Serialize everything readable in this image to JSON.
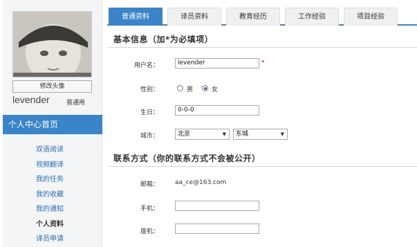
{
  "sidebar": {
    "avatar_button": "修改头像",
    "username": "levender",
    "user_type": "普通用",
    "home": "个人中心首页",
    "items": [
      {
        "label": "双语阅读"
      },
      {
        "label": "视频翻译"
      },
      {
        "label": "我的任务"
      },
      {
        "label": "我的收藏"
      },
      {
        "label": "我的通知"
      },
      {
        "label": "个人资料"
      },
      {
        "label": "译员申请"
      }
    ]
  },
  "tabs": [
    {
      "label": "普通资料"
    },
    {
      "label": "译员资料"
    },
    {
      "label": "教育经历"
    },
    {
      "label": "工作经验"
    },
    {
      "label": "项目经验"
    }
  ],
  "basic": {
    "title": "基本信息（加*为必填项）",
    "username_label": "用户名：",
    "username_value": "levender",
    "required_mark": "*",
    "gender_label": "性别：",
    "gender_male": "男",
    "gender_female": "女",
    "birthday_label": "生日：",
    "birthday_value": "0-0-0",
    "city_label": "城市：",
    "city_value": "北京",
    "district_value": "东城"
  },
  "contact": {
    "title": "联系方式（你的联系方式不会被公开）",
    "email_label": "邮箱：",
    "email_value": "aa_ce@163.com",
    "mobile_label": "手机：",
    "mobile_value": "",
    "phone_label": "座机：",
    "phone_value": ""
  },
  "colors": {
    "accent": "#3b84c7",
    "required": "#cc0000",
    "link": "#2b6fb0"
  },
  "icons": {
    "dropdown": "chevron-down-icon",
    "radio": "radio-icon"
  }
}
